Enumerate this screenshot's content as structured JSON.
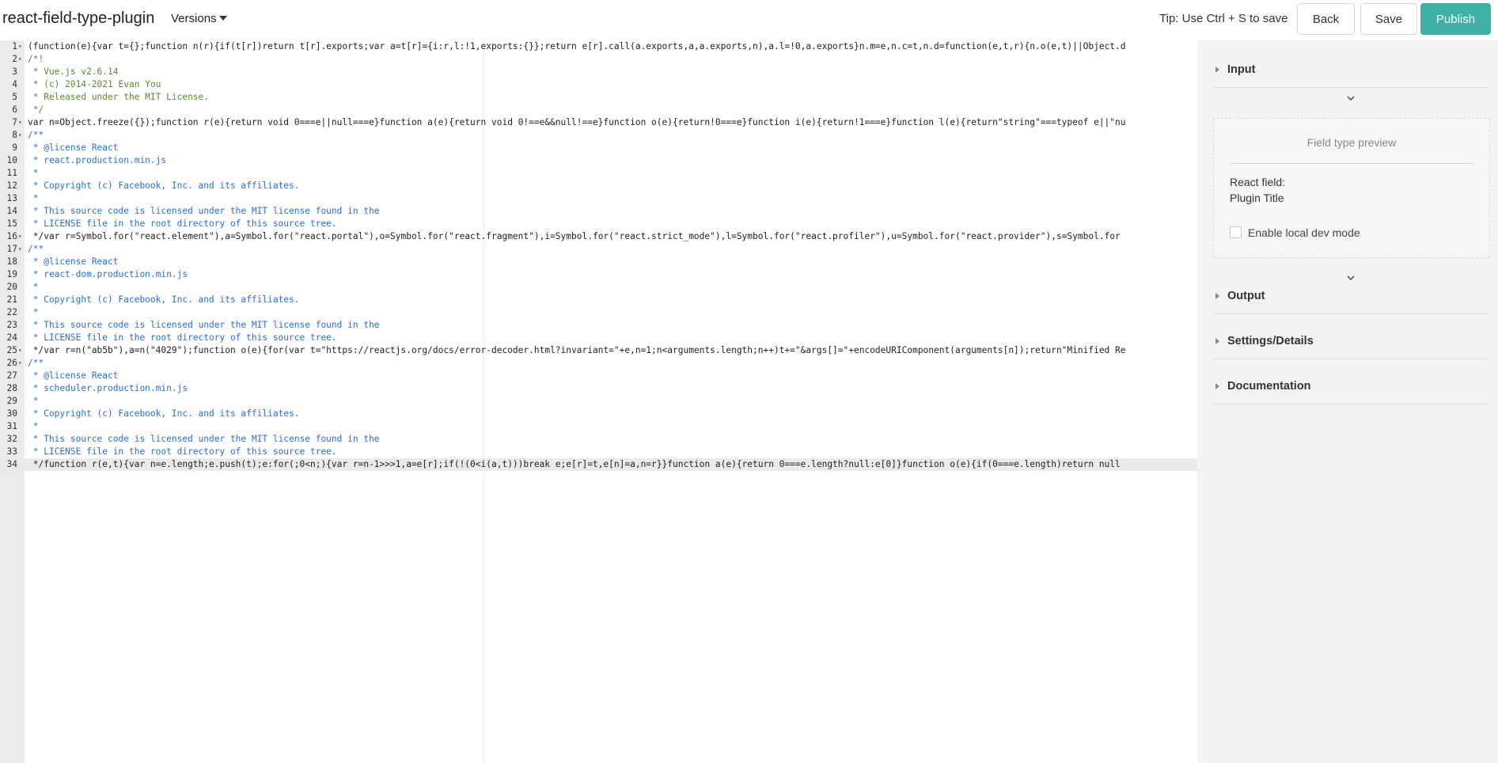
{
  "header": {
    "title": "react-field-type-plugin",
    "versions_label": "Versions",
    "tip": "Tip: Use Ctrl + S to save",
    "back_label": "Back",
    "save_label": "Save",
    "publish_label": "Publish"
  },
  "colors": {
    "publish": "#3eb1a5",
    "comment": "#236ee6",
    "doc_comment": "#5a8a2e"
  },
  "editor": {
    "active_line": 34,
    "lines": [
      {
        "n": "1",
        "fold": true,
        "t": "(function(e){var t={};function n(r){if(t[r])return t[r].exports;var a=t[r]={i:r,l:!1,exports:{}};return e[r].call(a.exports,a,a.exports,n),a.l=!0,a.exports}n.m=e,n.c=t,n.d=function(e,t,r){n.o(e,t)||Object.d"
      },
      {
        "n": "2",
        "fold": true,
        "t": "/*!",
        "c": "doc"
      },
      {
        "n": "3",
        "t": " * Vue.js v2.6.14",
        "c": "doc"
      },
      {
        "n": "4",
        "t": " * (c) 2014-2021 Evan You",
        "c": "doc"
      },
      {
        "n": "5",
        "t": " * Released under the MIT License.",
        "c": "doc"
      },
      {
        "n": "6",
        "t": " */",
        "c": "doc"
      },
      {
        "n": "7",
        "fold": true,
        "t": "var n=Object.freeze({});function r(e){return void 0===e||null===e}function a(e){return void 0!==e&&null!==e}function o(e){return!0===e}function i(e){return!1===e}function l(e){return\"string\"===typeof e||\"nu"
      },
      {
        "n": "8",
        "fold": true,
        "t": "/**",
        "c": "com"
      },
      {
        "n": "9",
        "t": " * @license React",
        "c": "com"
      },
      {
        "n": "10",
        "t": " * react.production.min.js",
        "c": "com"
      },
      {
        "n": "11",
        "t": " *",
        "c": "com"
      },
      {
        "n": "12",
        "t": " * Copyright (c) Facebook, Inc. and its affiliates.",
        "c": "com"
      },
      {
        "n": "13",
        "t": " *",
        "c": "com"
      },
      {
        "n": "14",
        "t": " * This source code is licensed under the MIT license found in the",
        "c": "com"
      },
      {
        "n": "15",
        "t": " * LICENSE file in the root directory of this source tree.",
        "c": "com"
      },
      {
        "n": "16",
        "fold": true,
        "t": " */var r=Symbol.for(\"react.element\"),a=Symbol.for(\"react.portal\"),o=Symbol.for(\"react.fragment\"),i=Symbol.for(\"react.strict_mode\"),l=Symbol.for(\"react.profiler\"),u=Symbol.for(\"react.provider\"),s=Symbol.for"
      },
      {
        "n": "17",
        "fold": true,
        "t": "/**",
        "c": "com"
      },
      {
        "n": "18",
        "t": " * @license React",
        "c": "com"
      },
      {
        "n": "19",
        "t": " * react-dom.production.min.js",
        "c": "com"
      },
      {
        "n": "20",
        "t": " *",
        "c": "com"
      },
      {
        "n": "21",
        "t": " * Copyright (c) Facebook, Inc. and its affiliates.",
        "c": "com"
      },
      {
        "n": "22",
        "t": " *",
        "c": "com"
      },
      {
        "n": "23",
        "t": " * This source code is licensed under the MIT license found in the",
        "c": "com"
      },
      {
        "n": "24",
        "t": " * LICENSE file in the root directory of this source tree.",
        "c": "com"
      },
      {
        "n": "25",
        "fold": true,
        "t": " */var r=n(\"ab5b\"),a=n(\"4029\");function o(e){for(var t=\"https://reactjs.org/docs/error-decoder.html?invariant=\"+e,n=1;n<arguments.length;n++)t+=\"&args[]=\"+encodeURIComponent(arguments[n]);return\"Minified Re"
      },
      {
        "n": "26",
        "fold": true,
        "t": "/**",
        "c": "com"
      },
      {
        "n": "27",
        "t": " * @license React",
        "c": "com"
      },
      {
        "n": "28",
        "t": " * scheduler.production.min.js",
        "c": "com"
      },
      {
        "n": "29",
        "t": " *",
        "c": "com"
      },
      {
        "n": "30",
        "t": " * Copyright (c) Facebook, Inc. and its affiliates.",
        "c": "com"
      },
      {
        "n": "31",
        "t": " *",
        "c": "com"
      },
      {
        "n": "32",
        "t": " * This source code is licensed under the MIT license found in the",
        "c": "com"
      },
      {
        "n": "33",
        "t": " * LICENSE file in the root directory of this source tree.",
        "c": "com"
      },
      {
        "n": "34",
        "t": " */function r(e,t){var n=e.length;e.push(t);e:for(;0<n;){var r=n-1>>>1,a=e[r];if(!(0<i(a,t)))break e;e[r]=t,e[n]=a,n=r}}function a(e){return 0===e.length?null:e[0]}function o(e){if(0===e.length)return null"
      }
    ]
  },
  "sidebar": {
    "input_label": "Input",
    "preview_title": "Field type preview",
    "field_label": "React field:",
    "field_value": "Plugin Title",
    "dev_mode_label": "Enable local dev mode",
    "dev_mode_checked": false,
    "output_label": "Output",
    "settings_label": "Settings/Details",
    "docs_label": "Documentation"
  }
}
